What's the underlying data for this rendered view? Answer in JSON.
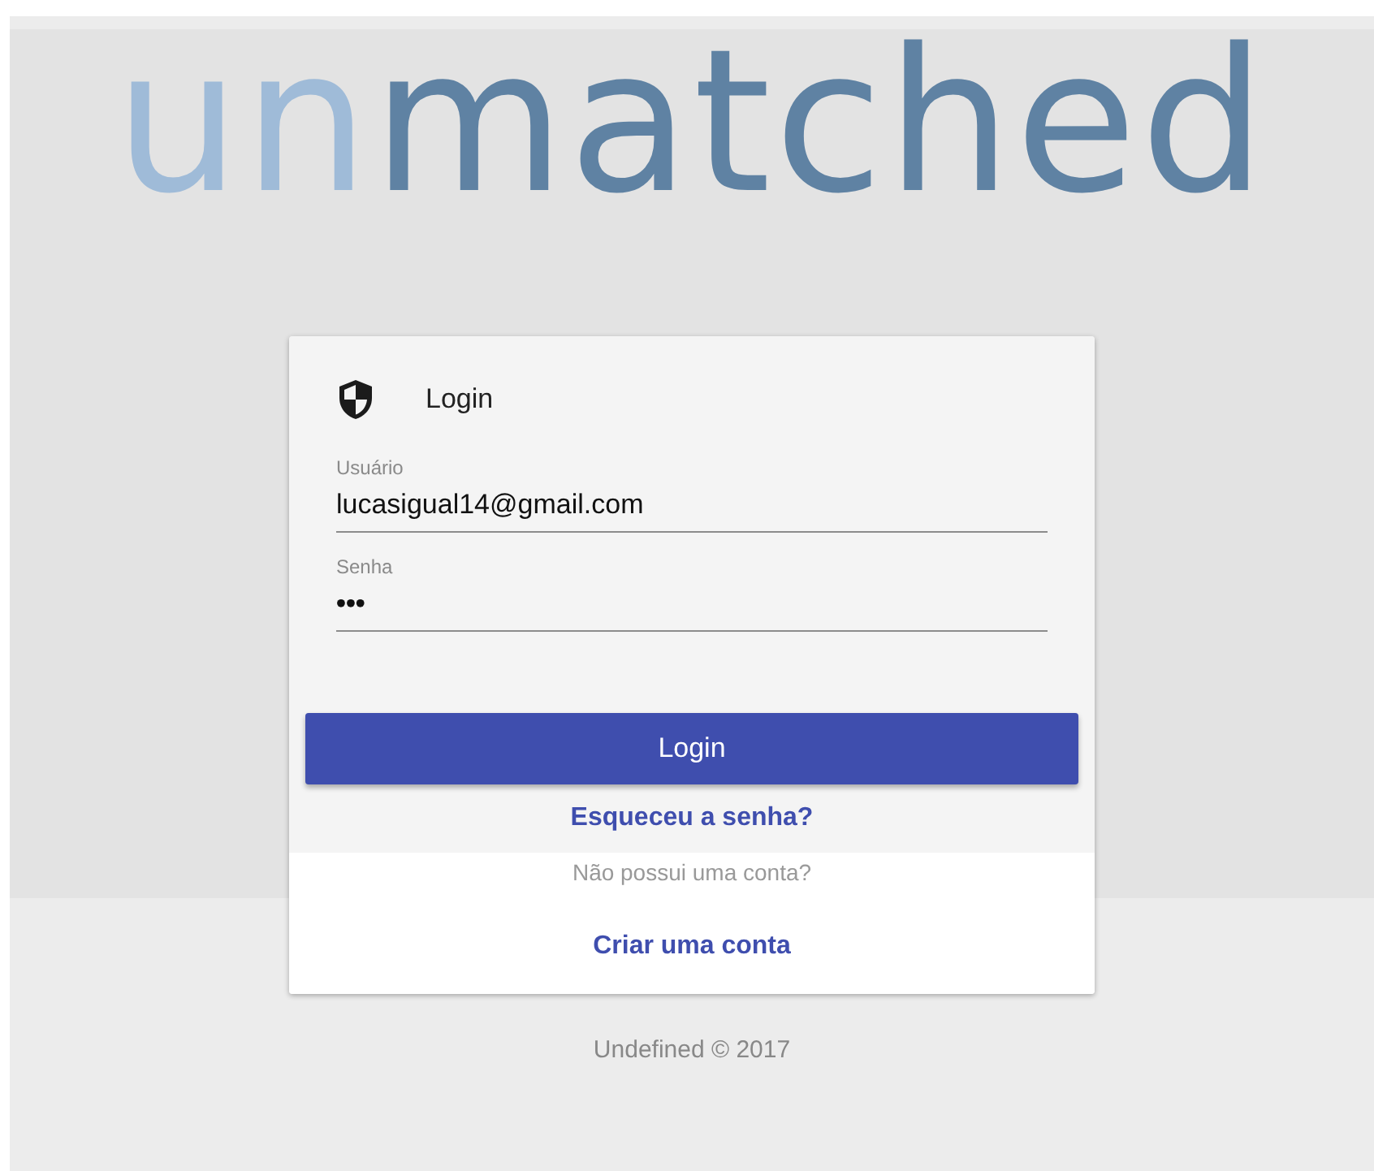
{
  "logo": {
    "parts": [
      {
        "text": "un",
        "color": "#9fbbd8"
      },
      {
        "text": "matched",
        "color": "#5f82a3"
      }
    ]
  },
  "card": {
    "title": "Login",
    "fields": [
      {
        "label": "Usuário",
        "value": "lucasigual14@gmail.com",
        "kind": "text"
      },
      {
        "label": "Senha",
        "value": "•••",
        "kind": "password"
      }
    ],
    "submit": "Login",
    "forgot": "Esqueceu a senha?",
    "no_account": "Não possui uma conta?",
    "create": "Criar uma conta"
  },
  "footer": "Undefined © 2017"
}
